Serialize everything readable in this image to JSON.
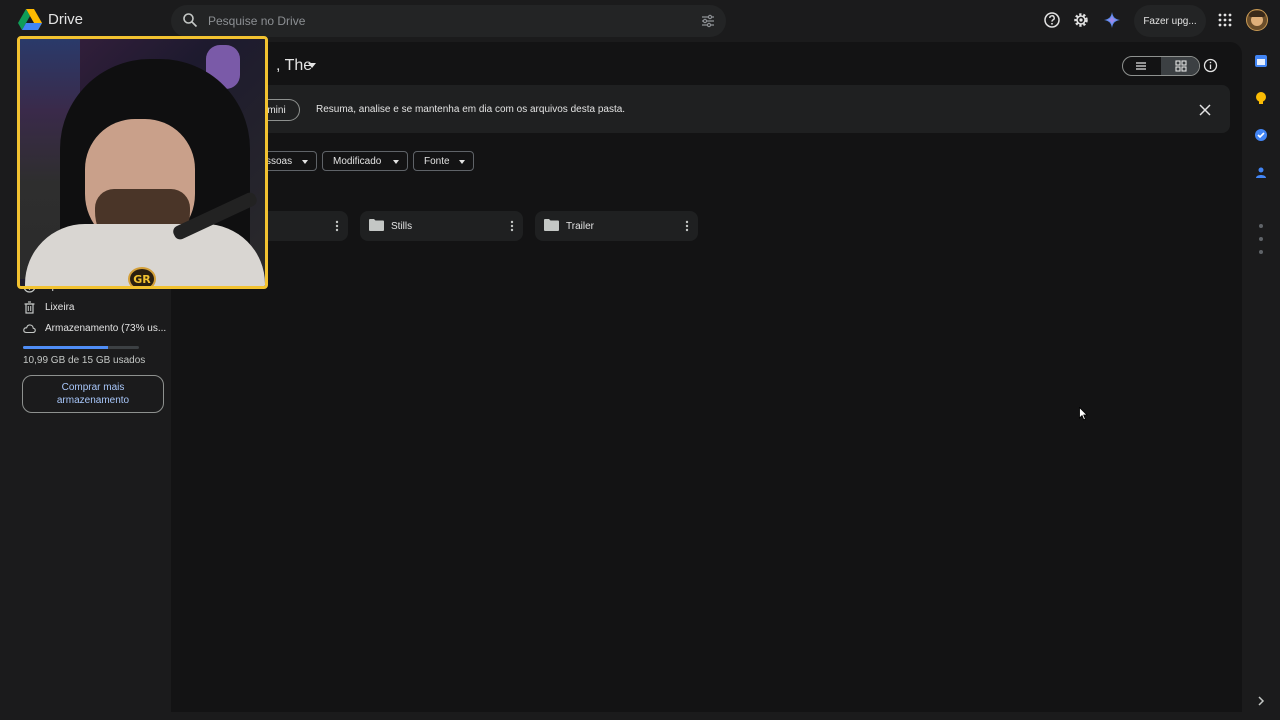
{
  "app": {
    "brand": "Drive"
  },
  "search": {
    "placeholder": "Pesquise no Drive"
  },
  "header": {
    "upgrade_label": "Fazer upg..."
  },
  "folder_view": {
    "title": ", The",
    "banner": {
      "chip_label": "mini",
      "text": "Resuma, analise e se mantenha em dia com os arquivos desta pasta."
    },
    "filters": [
      {
        "label": "ssoas"
      },
      {
        "label": "Modificado"
      },
      {
        "label": "Fonte"
      }
    ],
    "folders": [
      {
        "name": ""
      },
      {
        "name": "Stills"
      },
      {
        "name": "Trailer"
      }
    ]
  },
  "sidebar": {
    "items": [
      {
        "label": "Spam"
      },
      {
        "label": "Lixeira"
      },
      {
        "label": "Armazenamento (73% us..."
      }
    ],
    "storage": {
      "used_fraction": 0.73,
      "used_text": "10,99 GB de 15 GB usados",
      "buy_label": "Comprar mais armazenamento"
    }
  },
  "webcam": {
    "badge": "GR"
  },
  "colors": {
    "accent_blue": "#4f8df5",
    "link_blue": "#a8c7fa",
    "webcam_frame": "#f2c230",
    "background": "#1b1b1c",
    "surface": "#131314"
  }
}
